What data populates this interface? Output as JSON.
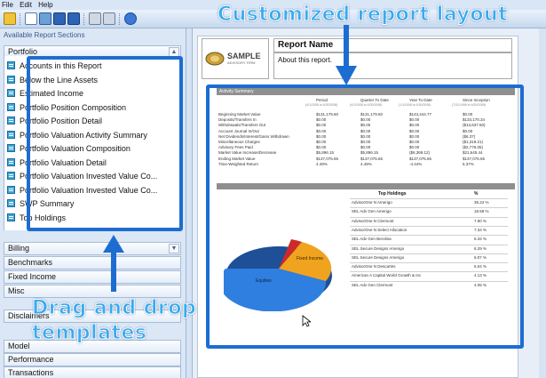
{
  "menu": [
    "File",
    "Edit",
    "Help"
  ],
  "left": {
    "title": "Available Report Sections",
    "categories_top": [
      "Portfolio"
    ],
    "portfolio_items": [
      "Accounts in this Report",
      "Below the Line Assets",
      "Estimated Income",
      "Portfolio Position Composition",
      "Portfolio Position Detail",
      "Portfolio Valuation Activity Summary",
      "Portfolio Valuation Composition",
      "Portfolio Valuation Detail",
      "Portfolio Valuation Invested Value Co...",
      "Portfolio Valuation Invested Value Co...",
      "SWP Summary",
      "Top Holdings"
    ],
    "categories": [
      "Billing",
      "Benchmarks",
      "Fixed Income",
      "Misc",
      "Disclaimers",
      "Model",
      "Performance",
      "Transactions"
    ]
  },
  "annotations": {
    "top": "Customized report layout",
    "left_line1": "Drag and drop",
    "left_line2": "templates"
  },
  "report": {
    "logo_line1": "SAMPLE",
    "logo_line2": "ADVISORY FIRM",
    "name": "Report Name",
    "about": "About this report.",
    "activity_title": "Activity Summary",
    "columns": [
      "Period",
      "Quarter To Date",
      "Year To Date",
      "Since Inception"
    ],
    "column_dates": [
      "(4/1/2008 to 6/30/2008)",
      "(4/1/2008 to 6/30/2008)",
      "(1/1/2008 to 6/30/2008)",
      "(7/31/1998 to 6/30/2008)"
    ],
    "rows": [
      {
        "label": "Beginning Market Value",
        "v": [
          "$131,179.60",
          "$131,179.60",
          "$143,444.77",
          "$0.00"
        ]
      },
      {
        "label": "Deposits/Transfers In",
        "v": [
          "$0.00",
          "$0.00",
          "$0.00",
          "$133,170.34"
        ]
      },
      {
        "label": "Withdrawals/Transfers Out",
        "v": [
          "$0.00",
          "$0.00",
          "$0.00",
          "($13,637.50)"
        ]
      },
      {
        "label": "Account Journal In/Out",
        "v": [
          "$0.00",
          "$0.00",
          "$0.00",
          "$0.00"
        ]
      },
      {
        "label": "Net Dividends/Interest/Gains Withdrawn",
        "v": [
          "$0.00",
          "$0.00",
          "$0.00",
          "($6.37)"
        ]
      },
      {
        "label": "Miscellaneous Charges",
        "v": [
          "$0.00",
          "$0.00",
          "$0.00",
          "($1,319.21)"
        ]
      },
      {
        "label": "Advisory Fees Paid",
        "v": [
          "$0.00",
          "$0.00",
          "$0.00",
          "($2,776.05)"
        ]
      },
      {
        "label": "Market Value Increase/Decrease",
        "v": [
          "$5,896.15",
          "$5,896.15",
          "($6,369.12)",
          "$21,645.44"
        ]
      },
      {
        "label": "Ending Market Value",
        "v": [
          "$137,075.65",
          "$137,075.65",
          "$137,075.65",
          "$137,075.65"
        ]
      },
      {
        "label": "Time-Weighted Return",
        "v": [
          "4.49%",
          "4.49%",
          "-4.44%",
          "5.37%"
        ]
      }
    ],
    "holdings_title": "Top Holdings",
    "holdings_pct": "%",
    "holdings": [
      {
        "name": "AdvisorOne N Amerigo",
        "pct": "35.24 %"
      },
      {
        "name": "SEL Adv Gen Amerigo",
        "pct": "18.59 %"
      },
      {
        "name": "AdvisorOne N Clermont",
        "pct": "7.90 %"
      },
      {
        "name": "AdvisorOne N Select Allocation",
        "pct": "7.34 %"
      },
      {
        "name": "SEL Adv Gen Berolina",
        "pct": "6.34 %"
      },
      {
        "name": "SEL Secure Designs Amerigo",
        "pct": "6.29 %"
      },
      {
        "name": "SEL Secure Designs Amerigo",
        "pct": "6.07 %"
      },
      {
        "name": "AdvisorOne N Descartes",
        "pct": "6.04 %"
      },
      {
        "name": "American A Capital World Growth & Inc",
        "pct": "4.13 %"
      },
      {
        "name": "SEL Adv Gen Clermont",
        "pct": "4.05 %"
      }
    ],
    "pie_labels": [
      "Equities",
      "Fixed Income"
    ]
  },
  "colors": {
    "highlight": "#1d6dd1",
    "callout": "#39aaf0",
    "pie_blue": "#2f7fe0",
    "pie_orange": "#f0a31e",
    "pie_red": "#cc2a2a"
  }
}
